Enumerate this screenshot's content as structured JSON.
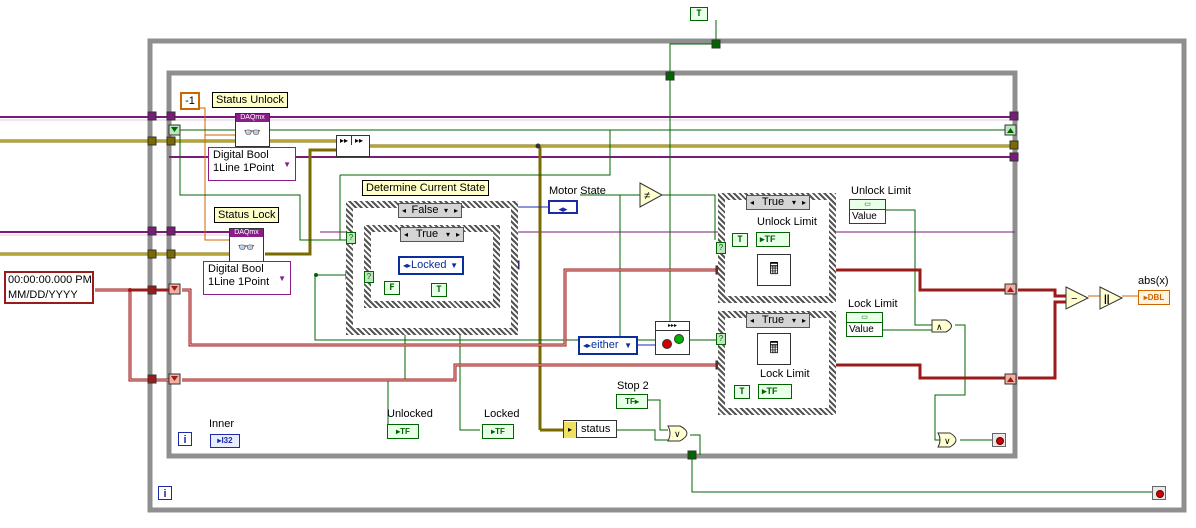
{
  "constants": {
    "neg_one": "-1",
    "false_bool": "F",
    "true_bool": "T",
    "top_true": "T"
  },
  "labels": {
    "status_unlock": "Status Unlock",
    "status_lock": "Status Lock",
    "determine_state": "Determine Current State",
    "motor_state": "Motor State",
    "unlock_limit_outer": "Unlock Limit",
    "lock_limit_outer": "Lock Limit",
    "unlock_limit_inner": "Unlock Limit",
    "lock_limit_inner": "Lock Limit",
    "abs": "abs(x)",
    "stop2": "Stop 2",
    "unlocked": "Unlocked",
    "locked": "Locked",
    "inner": "Inner",
    "status": "status"
  },
  "rings": {
    "ring1_line1": "Digital Bool",
    "ring1_line2": "1Line 1Point",
    "ring2_line1": "Digital Bool",
    "ring2_line2": "1Line 1Point"
  },
  "timestamp": {
    "line1": "00:00:00.000 PM",
    "line2": "MM/DD/YYYY"
  },
  "case_selectors": {
    "outer": "False",
    "inner": "True",
    "unlock_case": "True",
    "lock_case": "True"
  },
  "enums": {
    "locked": "Locked",
    "either": "either"
  },
  "terminals": {
    "tf": "TF",
    "dbl": "DBL",
    "i32": "I32",
    "value": "Value",
    "iter": "i",
    "daqmx": "DAQmx"
  },
  "colors": {
    "bool_wire": "#006400",
    "daq_wire": "#7a1b7a",
    "err_wire": "#7a6a00",
    "dbl_wire": "#cc6600",
    "time_wire": "#9b1b1b",
    "enum_wire": "#1c2aa8"
  }
}
